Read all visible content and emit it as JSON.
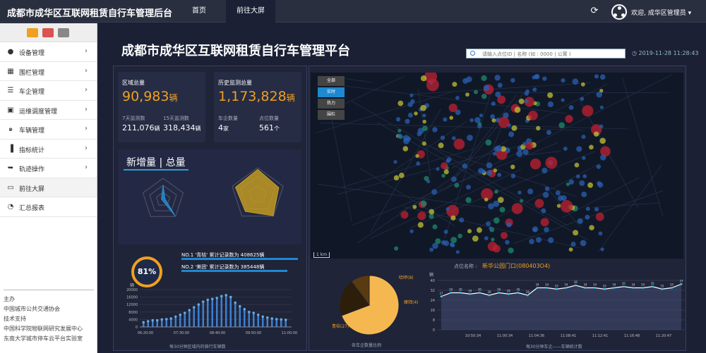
{
  "app": {
    "title": "成都市成华区互联网租赁自行车管理后台"
  },
  "nav": {
    "tabs": [
      "首页",
      "前往大屏"
    ]
  },
  "user": {
    "welcome": "欢迎, 成华区管理员"
  },
  "sidebar": {
    "items": [
      {
        "label": "设备管理",
        "icon": "location-pin-icon"
      },
      {
        "label": "围栏管理",
        "icon": "map-icon"
      },
      {
        "label": "车企管理",
        "icon": "list-icon"
      },
      {
        "label": "运维调度管理",
        "icon": "id-card-icon"
      },
      {
        "label": "车辆管理",
        "icon": "bicycle-icon"
      },
      {
        "label": "指标统计",
        "icon": "bar-chart-icon"
      },
      {
        "label": "轨迹操作",
        "icon": "arrow-right-icon"
      },
      {
        "label": "前往大屏",
        "icon": "monitor-icon"
      },
      {
        "label": "汇总报表",
        "icon": "dashboard-icon"
      }
    ],
    "footer": [
      "主办",
      "中国城市公共交通协会",
      "技术支持",
      "中国科学院物联网研究发展中心",
      "东南大学城市停车云平台实验室"
    ]
  },
  "dashboard": {
    "title": "成都市成华区互联网租赁自行车管理平台",
    "search_placeholder": "请输入点位ID | 名称 (如 : 0000 | 公寓 )",
    "datetime": "2019-11-28 11:28:43",
    "region_total": {
      "label": "区域总量",
      "value": "90,983",
      "unit": "辆"
    },
    "history_total": {
      "label": "历史监测总量",
      "value": "1,173,828",
      "unit": "辆"
    },
    "seven_day": {
      "label": "7天监测数",
      "value": "211,076",
      "unit": "辆"
    },
    "fifteen_day": {
      "label": "15天监测数",
      "value": "318,434",
      "unit": "辆"
    },
    "companies": {
      "label": "车企数量",
      "value": "4",
      "unit": "家"
    },
    "points": {
      "label": "点位数量",
      "value": "561",
      "unit": "个"
    },
    "new_total_title": "新增量 | 总量",
    "percent": "81%",
    "rank": [
      "NO.1 '青桔' 累计记录数为 408625辆",
      "NO.2 '美团' 累计记录数为 385448辆"
    ],
    "map_tabs": [
      "全部",
      "实时",
      "热力",
      "围栏"
    ],
    "map_scale": "1 km",
    "point_name_label": "点位名称 :",
    "point_name": "新华公园门口(080403O4)",
    "pie_caption": "各车企数量比例",
    "line_caption": "每30分钟车企——车辆统计数",
    "bar_caption": "每30分钟区域内的骑行车辆数"
  },
  "chart_data": [
    {
      "type": "pie",
      "labels": [
        "青桔(27)",
        "哈啰(8)",
        "摩拜(4)"
      ],
      "values": [
        27,
        8,
        4
      ]
    },
    {
      "type": "line",
      "title": "",
      "ylabel": "辆",
      "ylim": [
        0,
        40
      ],
      "x": [
        "10:50:34",
        "11:00:34",
        "11:04:36",
        "11:08:41",
        "11:12:41",
        "11:16:48",
        "11:20:47"
      ],
      "values": [
        27,
        30,
        30,
        29,
        30,
        28,
        30,
        29,
        30,
        28,
        34,
        34,
        33,
        34,
        36,
        34,
        34,
        33,
        34,
        35,
        34,
        34,
        35,
        33,
        34,
        37
      ],
      "ylabels": [
        0,
        8,
        16,
        24,
        32,
        40
      ]
    },
    {
      "type": "bar",
      "ylabel": "辆",
      "ylim": [
        0,
        20000
      ],
      "x": [
        "06:20:00",
        "07:30:00",
        "08:40:00",
        "09:50:00",
        "11:00:00"
      ],
      "ylabels": [
        0,
        4000,
        8000,
        12000,
        16000,
        20000
      ]
    },
    {
      "type": "radar",
      "values": [
        24415,
        3412,
        35000,
        2049,
        3007
      ]
    },
    {
      "type": "radar",
      "values": [
        43000,
        38000,
        45000,
        36000,
        40000
      ]
    }
  ]
}
